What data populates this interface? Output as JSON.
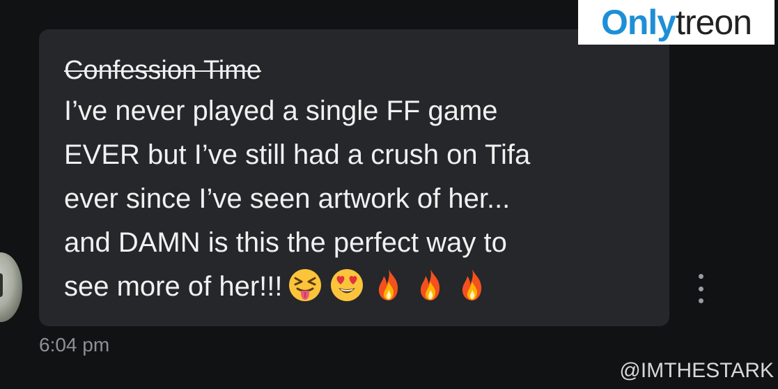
{
  "message": {
    "title": "Confession Time",
    "lines": [
      "I’ve never played a single FF game",
      "EVER but I’ve still had a crush on Tifa",
      "ever since I’ve seen artwork of her...",
      "and DAMN is this the perfect way to",
      "see more of her!!!"
    ],
    "emojis": [
      "squinting-face-with-tongue-icon",
      "smiling-face-with-heart-eyes-icon",
      "fire-icon",
      "fire-icon",
      "fire-icon"
    ],
    "timestamp": "6:04 pm"
  },
  "watermark": {
    "brand_part1": "Only",
    "brand_part2": "treon",
    "handle": "@IMTHESTARK"
  },
  "colors": {
    "background": "#111214",
    "bubble": "#25272a",
    "text": "#f1f1f1",
    "muted": "#8e9094",
    "brand_blue": "#1e8fd6"
  }
}
